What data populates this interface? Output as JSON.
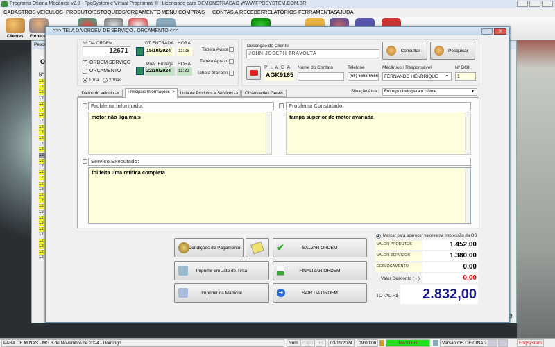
{
  "app": {
    "title": "Programa Oficina Mecânica v2.0 - FpqSystem e Virtual Programas ® | Licenciado para  DEMONSTRACAO WWW.FPQSYSTEM.COM.BR"
  },
  "menu": [
    "CADASTROS",
    "VEICULOS",
    "PRODUTO/ESTOQUE",
    "OS/ORÇAMENTO",
    "MENU COMPRAS",
    "CONTAS A RECEBER",
    "RELATÓRIOS",
    "FERRAMENTAS",
    "AJUDA"
  ],
  "toolbar": {
    "clientes": "Clientes",
    "fornecedores": "Fornece"
  },
  "backwin": {
    "title": "Pesqu",
    "label": "O",
    "col": "Nº",
    "rows": [
      "12",
      "12",
      "12",
      "12",
      "12",
      "12",
      "12",
      "12",
      "12",
      "12",
      "12",
      "12",
      "12",
      "12",
      "12",
      "12",
      "12",
      "12",
      "12",
      "12",
      "12",
      "12",
      "12",
      "12",
      "12",
      "12",
      "12",
      "12",
      "12",
      "12",
      "12",
      "12"
    ],
    "tail": "9"
  },
  "dialog": {
    "title": ">>>  TELA DA ORDEM DE SERVIÇO / ORÇAMENTO  <<<",
    "order_label": "Nº DA ORDEM",
    "order_number": "12671",
    "ordem_servico": "ORDEM SERVIÇO",
    "orcamento": "ORÇAMENTO",
    "via1": "1 Via",
    "via2": "2 Vias",
    "dt_entrada_label": "DT ENTRADA",
    "hora_label": "HORA",
    "dt_entrada": "15/10/2024",
    "hora_entrada": "11:26",
    "prev_label": "Prev. Entrega",
    "prev_entrega": "22/10/2024",
    "hora_prev": "11:32",
    "tabela_avista": "Tabela Avista",
    "tabela_aprazo": "Tabela Aprazo",
    "tabela_atacado": "Tabela Atacado",
    "cliente_label": "Descrição do Cliente",
    "cliente": "JOHN JOSEPH TRAVOLTA",
    "consultar": "Consultar",
    "pesquisar": "Pesquisar",
    "placa_label": "P L A C A",
    "placa": "AGK9165",
    "contato_label": "Nome do Contato",
    "contato": "",
    "telefone_label": "Telefone",
    "telefone": "(66) 6666-6666",
    "mecanico_label": "Mecânico / Responsável",
    "mecanico": "FERNANDO HENRRIQUE",
    "box_label": "Nº BOX",
    "box": "1",
    "tabs": [
      "Dados do Veiculo ->",
      "Principais Informações ->",
      "Lista de Produtos e Serviços ->",
      "Observações Gerais"
    ],
    "situacao_label": "Situação Atual:",
    "situacao": "Entrega direto para o cliente",
    "problema_informado_label": "Problema Informado:",
    "problema_informado": "motor não liga mais",
    "problema_constatado_label": "Problema Constatado:",
    "problema_constatado": "tampa superior do motor avariada",
    "servico_label": "Servico Executado:",
    "servico": "foi feita uma retifica completa",
    "buttons": {
      "pagamento": "Condições de Pagamento",
      "salvar": "SALVAR ORDEM",
      "jato": "Imprimir em Jato de Tinta",
      "finalizar": "FINALIZAR ORDEM",
      "matricial": "Imprimir na Matricial",
      "sair": "SAIR DA ORDEM"
    },
    "marcar": "Marcar para aparecer valores na Impressão da OS",
    "valores": {
      "produtos_label": "VALOR PRODUTOS",
      "produtos": "1.452,00",
      "servicos_label": "VALOR SERVICOS",
      "servicos": "1.380,00",
      "desloc_label": "DESLOCAMENTO",
      "desloc": "0,00",
      "desconto_label": "Valor Desconto ( - )",
      "desconto": "0,00",
      "total_label": "TOTAL R$",
      "total": "2.832,00"
    },
    "colors": {
      "total": "#1a1a8c",
      "desconto": "#e00000",
      "textarea": "#ffffdc"
    }
  },
  "status": {
    "local": "PARA DE MINAS - MG  3 de Novembro de 2024 - Domingo",
    "num": "Num",
    "caps": "Caps",
    "ins": "Ins",
    "date": "03/11/2024",
    "time": "09:00:00",
    "user": "MASTER",
    "versao": "Versão OS OFICINA 2.0",
    "brand": "FpqSystem"
  }
}
